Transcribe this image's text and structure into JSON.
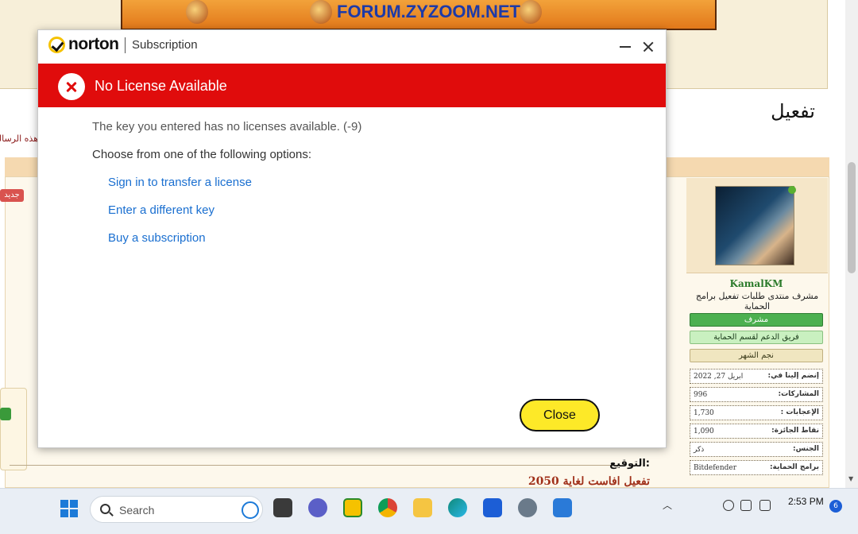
{
  "forum": {
    "banner_text": "FORUM.ZYZOOM.NET",
    "thread_title": "تفعيل",
    "message_hint": "هذه الرسالة",
    "new_badge": "جديد",
    "signature_label": "التوقيع:",
    "signature_text": "تفعيل افاست لغاية 2050",
    "profile": {
      "username": "KamalKM",
      "user_title": "مشرف منتدى طلبات تفعيل برامج الحماية",
      "ranks": [
        "مشرف",
        "فريق الدعم لقسم الحماية",
        "نجم الشهر"
      ],
      "stats": [
        {
          "label": "إنضم إلينا في:",
          "value": "ابريل 27, 2022"
        },
        {
          "label": "المشاركات:",
          "value": "996"
        },
        {
          "label": "الإعجابات :",
          "value": "1,730"
        },
        {
          "label": "نقاط الجائزة:",
          "value": "1,090"
        },
        {
          "label": "الجنس:",
          "value": "ذكر"
        },
        {
          "label": "برامج الحماية:",
          "value": "Bitdefender"
        }
      ]
    }
  },
  "dialog": {
    "brand": "norton",
    "title": "Subscription",
    "error_title": "No License Available",
    "message": "The key you entered has no licenses available. (-9)",
    "options_heading": "Choose from one of the following options:",
    "options": [
      "Sign in to transfer a license",
      "Enter a different key",
      "Buy a subscription"
    ],
    "close_label": "Close",
    "colors": {
      "error_red": "#e00c0c",
      "link_blue": "#1a6fd0",
      "button_yellow": "#fde928"
    }
  },
  "taskbar": {
    "search_placeholder": "Search",
    "time": "2:53 PM",
    "notification_count": "6"
  }
}
